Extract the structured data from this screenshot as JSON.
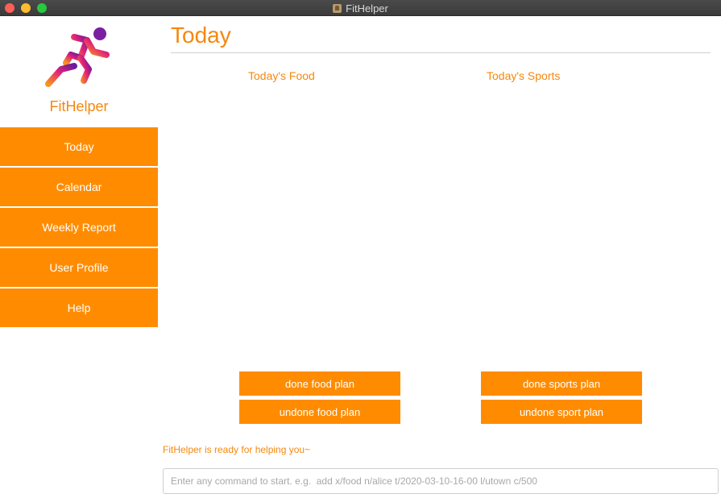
{
  "window": {
    "title": "FitHelper"
  },
  "sidebar": {
    "brand": "FitHelper",
    "items": [
      {
        "label": "Today"
      },
      {
        "label": "Calendar"
      },
      {
        "label": "Weekly Report"
      },
      {
        "label": "User Profile"
      },
      {
        "label": "Help"
      }
    ]
  },
  "main": {
    "title": "Today",
    "food_label": "Today's Food",
    "sports_label": "Today's Sports",
    "buttons": {
      "done_food": "done food plan",
      "undone_food": "undone food plan",
      "done_sports": "done sports plan",
      "undone_sports": "undone sport plan"
    }
  },
  "status": {
    "message": "FitHelper is ready for helping you~"
  },
  "command": {
    "value": "",
    "placeholder": "Enter any command to start. e.g.  add x/food n/alice t/2020-03-10-16-00 l/utown c/500"
  },
  "colors": {
    "accent": "#ff8c00",
    "accent_text": "#f5880f",
    "logo_gradient_start": "#f7941d",
    "logo_gradient_end": "#6a1b9a"
  }
}
